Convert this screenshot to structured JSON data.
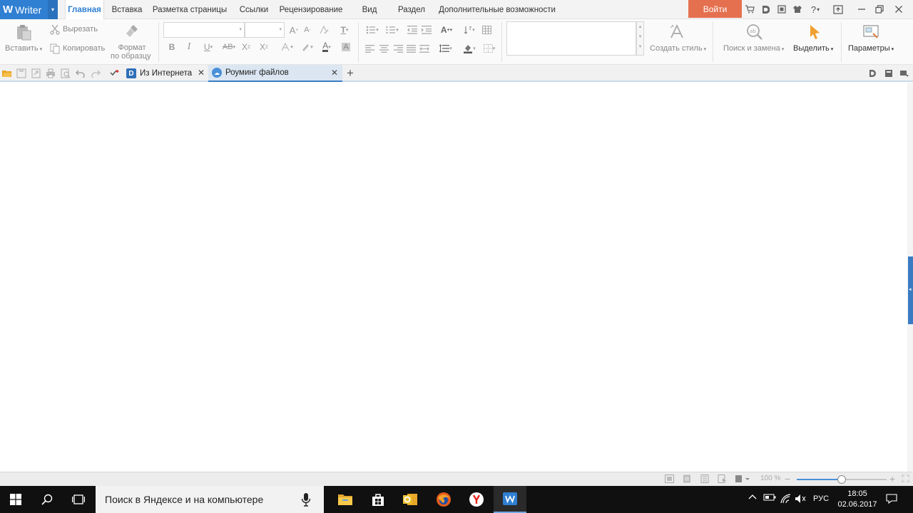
{
  "app": {
    "name": "Writer"
  },
  "menu": {
    "tabs": [
      "Главная",
      "Вставка",
      "Разметка страницы",
      "Ссылки",
      "Рецензирование",
      "Вид",
      "Раздел",
      "Дополнительные возможности"
    ],
    "login_label": "Войти",
    "help_label": "?"
  },
  "ribbon": {
    "paste_label": "Вставить",
    "cut_label": "Вырезать",
    "copy_label": "Копировать",
    "format_painter_line1": "Формат",
    "format_painter_line2": "по образцу",
    "font_name_value": "",
    "font_size_value": "",
    "style_gallery_value": "",
    "create_style_label": "Создать стиль",
    "find_replace_label": "Поиск и замена",
    "select_label": "Выделить",
    "settings_label": "Параметры"
  },
  "doc_tabs": [
    {
      "label": "Из Интернета"
    },
    {
      "label": "Роуминг файлов"
    }
  ],
  "statusbar": {
    "zoom": "100 %",
    "zoom_fraction": 0.5
  },
  "taskbar": {
    "search_placeholder": "Поиск в Яндексе и на компьютере",
    "lang": "РУС",
    "time": "18:05",
    "date": "02.06.2017"
  },
  "colors": {
    "accent": "#2f7fd2",
    "login": "#e5704f",
    "taskbar": "#101010"
  }
}
